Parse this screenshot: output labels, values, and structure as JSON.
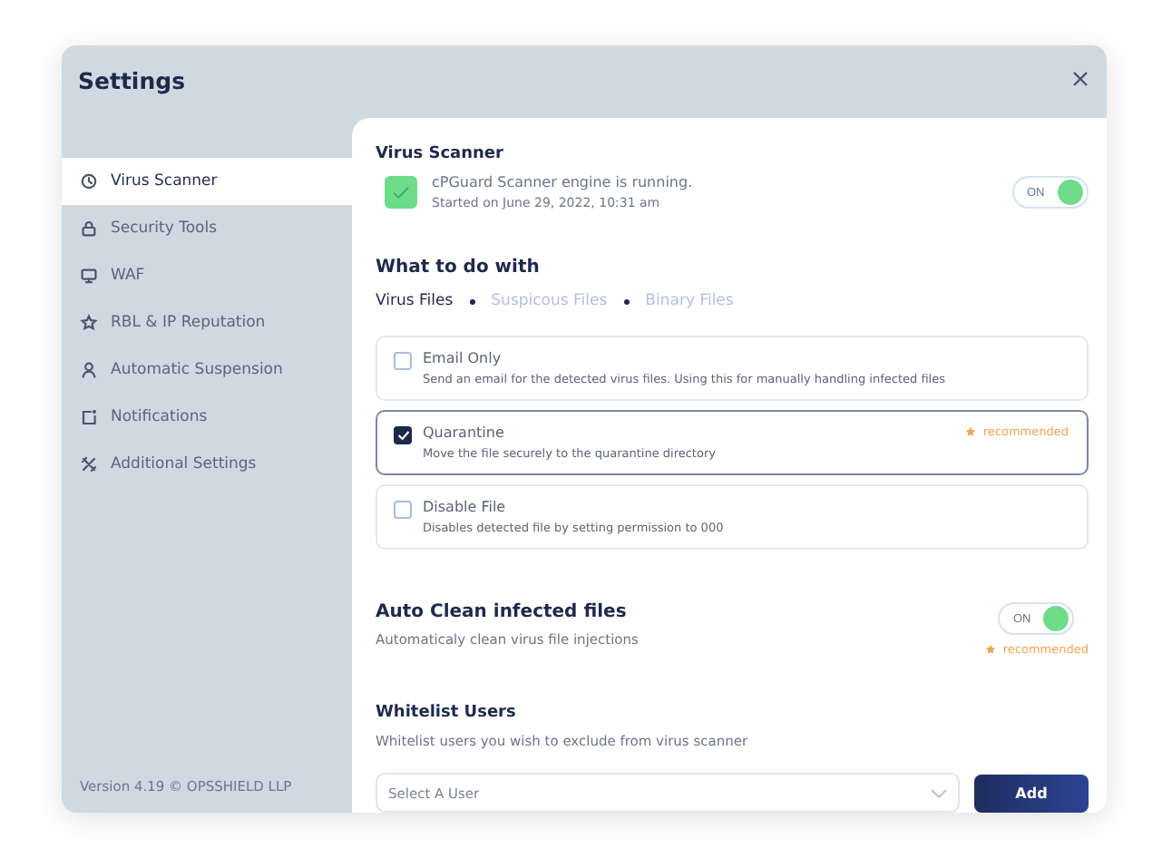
{
  "window": {
    "title": "Settings"
  },
  "sidebar": {
    "items": [
      {
        "label": "Virus Scanner",
        "selected": true
      },
      {
        "label": "Security Tools",
        "selected": false
      },
      {
        "label": "WAF",
        "selected": false
      },
      {
        "label": "RBL & IP Reputation",
        "selected": false
      },
      {
        "label": "Automatic Suspension",
        "selected": false
      },
      {
        "label": "Notifications",
        "selected": false
      },
      {
        "label": "Additional Settings",
        "selected": false
      }
    ],
    "footer": "Version 4.19 © OPSSHIELD LLP"
  },
  "scanner": {
    "title": "Virus Scanner",
    "status": "cPGuard Scanner engine is running.",
    "started": "Started on June 29, 2022, 10:31 am",
    "toggle": {
      "label": "ON",
      "on": true
    }
  },
  "actions": {
    "title": "What to do with",
    "tabs": [
      {
        "label": "Virus Files",
        "selected": true
      },
      {
        "label": "Suspicous Files",
        "selected": false
      },
      {
        "label": "Binary Files",
        "selected": false
      }
    ],
    "options": [
      {
        "label": "Email Only",
        "description": "Send an email for the detected virus files. Using this for manually handling infected files",
        "checked": false
      },
      {
        "label": "Quarantine",
        "description": "Move the file securely to the quarantine directory",
        "checked": true,
        "badge": "recommended"
      },
      {
        "label": "Disable File",
        "description": "Disables detected file by setting permission to 000",
        "checked": false
      }
    ]
  },
  "auto_clean": {
    "title": "Auto Clean infected files",
    "description": "Automaticaly clean virus file injections",
    "toggle": {
      "label": "ON",
      "on": true
    },
    "badge": "recommended"
  },
  "whitelist": {
    "title": "Whitelist Users",
    "description": "Whitelist users you wish to exclude from virus scanner",
    "select": {
      "placeholder": "Select A User"
    },
    "button": "Add"
  }
}
